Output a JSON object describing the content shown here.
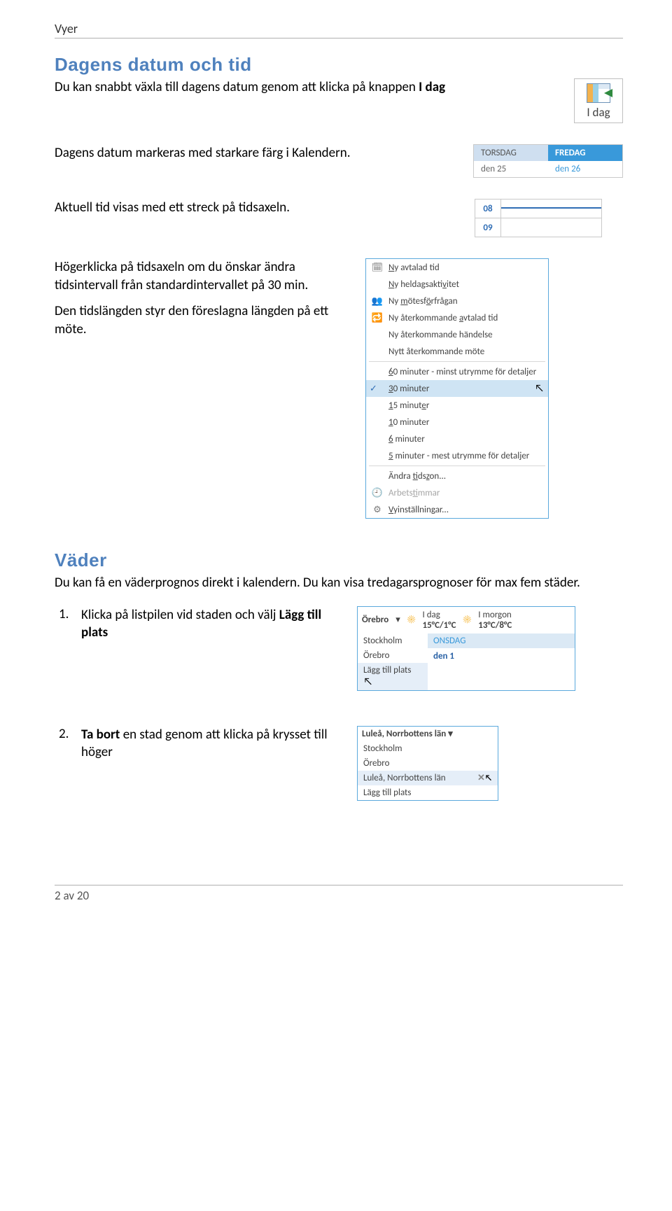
{
  "header": "Vyer",
  "section1": {
    "title": "Dagens datum och tid",
    "p1a": "Du kan snabbt växla till dagens datum genom att klicka på knappen ",
    "p1b": "I dag",
    "p2": "Dagens datum markeras med starkare färg i Kalendern.",
    "p3": "Aktuell tid visas med ett streck på tidsaxeln.",
    "p4": "Högerklicka på tidsaxeln om du önskar ändra tidsintervall från standardintervallet på 30 min.",
    "p5": "Den tidslängden styr den föreslagna längden på ett möte."
  },
  "idag_label": "I dag",
  "daytable": {
    "th1": "TORSDAG",
    "th2": "FREDAG",
    "d1": "den 25",
    "d2": "den 26"
  },
  "timeaxis": {
    "h1": "08",
    "h2": "09"
  },
  "menu": {
    "i1": "Ny avtalad tid",
    "i1u": "N",
    "i2": "Ny heldagsaktivitet",
    "i2u": "N",
    "i3": "Ny mötesförfrågan",
    "i3u": "m",
    "i4": "Ny återkommande avtalad tid",
    "i4u": "a",
    "i5": "Ny återkommande händelse",
    "i6": "Nytt återkommande möte",
    "i7": "60 minuter - minst utrymme för detaljer",
    "i7u": "6",
    "i8": "30 minuter",
    "i8u": "3",
    "i9": "15 minuter",
    "i9u": "1",
    "i10": "10 minuter",
    "i10u": "1",
    "i11": "6 minuter",
    "i11u": "6",
    "i12": "5 minuter - mest utrymme för detaljer",
    "i12u": "5",
    "i13": "Ändra tidszon...",
    "i13u": "t",
    "i14": "Arbetstimmar",
    "i14u": "t",
    "i15": "Vyinställningar...",
    "i15u": "V"
  },
  "section2": {
    "title": "Väder",
    "p1": "Du kan få en väderprognos direkt i kalendern. Du kan visa tredagarsprognoser för max fem städer.",
    "step1a": "Klicka på listpilen vid staden och välj ",
    "step1b": "Lägg till plats",
    "step2a": "Ta bort",
    "step2b": " en stad genom att klicka på krysset till höger"
  },
  "weather1": {
    "city": "Örebro",
    "today_lbl": "I dag",
    "today_temp": "15°C/1°C",
    "tomorrow_lbl": "I morgon",
    "tomorrow_temp": "13°C/8°C",
    "opt1": "Stockholm",
    "opt2": "Örebro",
    "opt3": "Lägg till plats",
    "dayhdr": "ONSDAG",
    "daycell": "den 1"
  },
  "weather2": {
    "city": "Luleå, Norrbottens län",
    "opt1": "Stockholm",
    "opt2": "Örebro",
    "opt3": "Luleå, Norrbottens län",
    "opt4": "Lägg till plats"
  },
  "footer": "2 av 20"
}
